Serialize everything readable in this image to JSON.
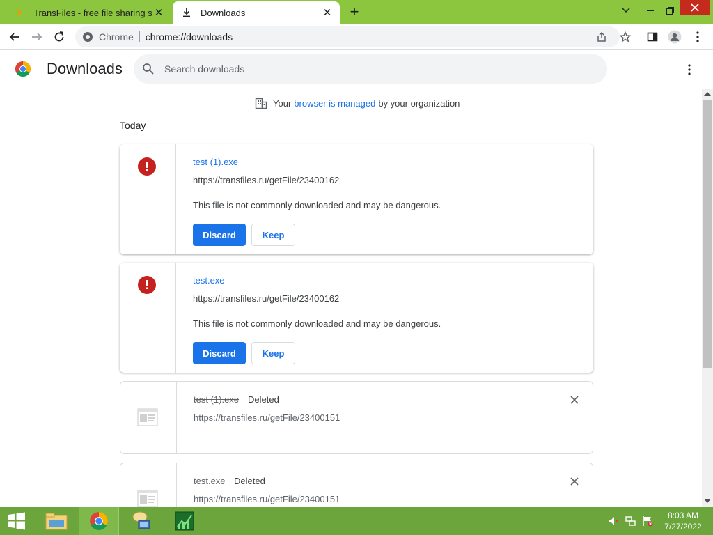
{
  "tabs": [
    {
      "title": "TransFiles - free file sharing serv",
      "icon": "transfiles-favicon"
    },
    {
      "title": "Downloads",
      "icon": "download-icon"
    }
  ],
  "window_controls": {
    "minimize": "minimize-icon",
    "restore": "restore-icon",
    "close": "close-icon"
  },
  "omnibox": {
    "site_label": "Chrome",
    "url": "chrome://downloads"
  },
  "page": {
    "title": "Downloads",
    "search_placeholder": "Search downloads",
    "managed_prefix": "Your",
    "managed_link": "browser is managed",
    "managed_suffix": "by your organization",
    "section_label": "Today"
  },
  "downloads": [
    {
      "name": "test (1).exe",
      "url": "https://transfiles.ru/getFile/23400162",
      "warning": "This file is not commonly downloaded and may be dangerous.",
      "discard": "Discard",
      "keep": "Keep"
    },
    {
      "name": "test.exe",
      "url": "https://transfiles.ru/getFile/23400162",
      "warning": "This file is not commonly downloaded and may be dangerous.",
      "discard": "Discard",
      "keep": "Keep"
    },
    {
      "name": "test (1).exe",
      "status": "Deleted",
      "url": "https://transfiles.ru/getFile/23400151"
    },
    {
      "name": "test.exe",
      "status": "Deleted",
      "url": "https://transfiles.ru/getFile/23400151"
    }
  ],
  "taskbar": {
    "items": [
      "start-icon",
      "file-explorer-icon",
      "chrome-icon",
      "network-tool-icon",
      "task-manager-icon"
    ],
    "time": "8:03 AM",
    "date": "7/27/2022"
  },
  "colors": {
    "tabstrip": "#8cc63f",
    "taskbar": "#6ba53b",
    "accent": "#1a73e8",
    "danger": "#c5221f"
  }
}
